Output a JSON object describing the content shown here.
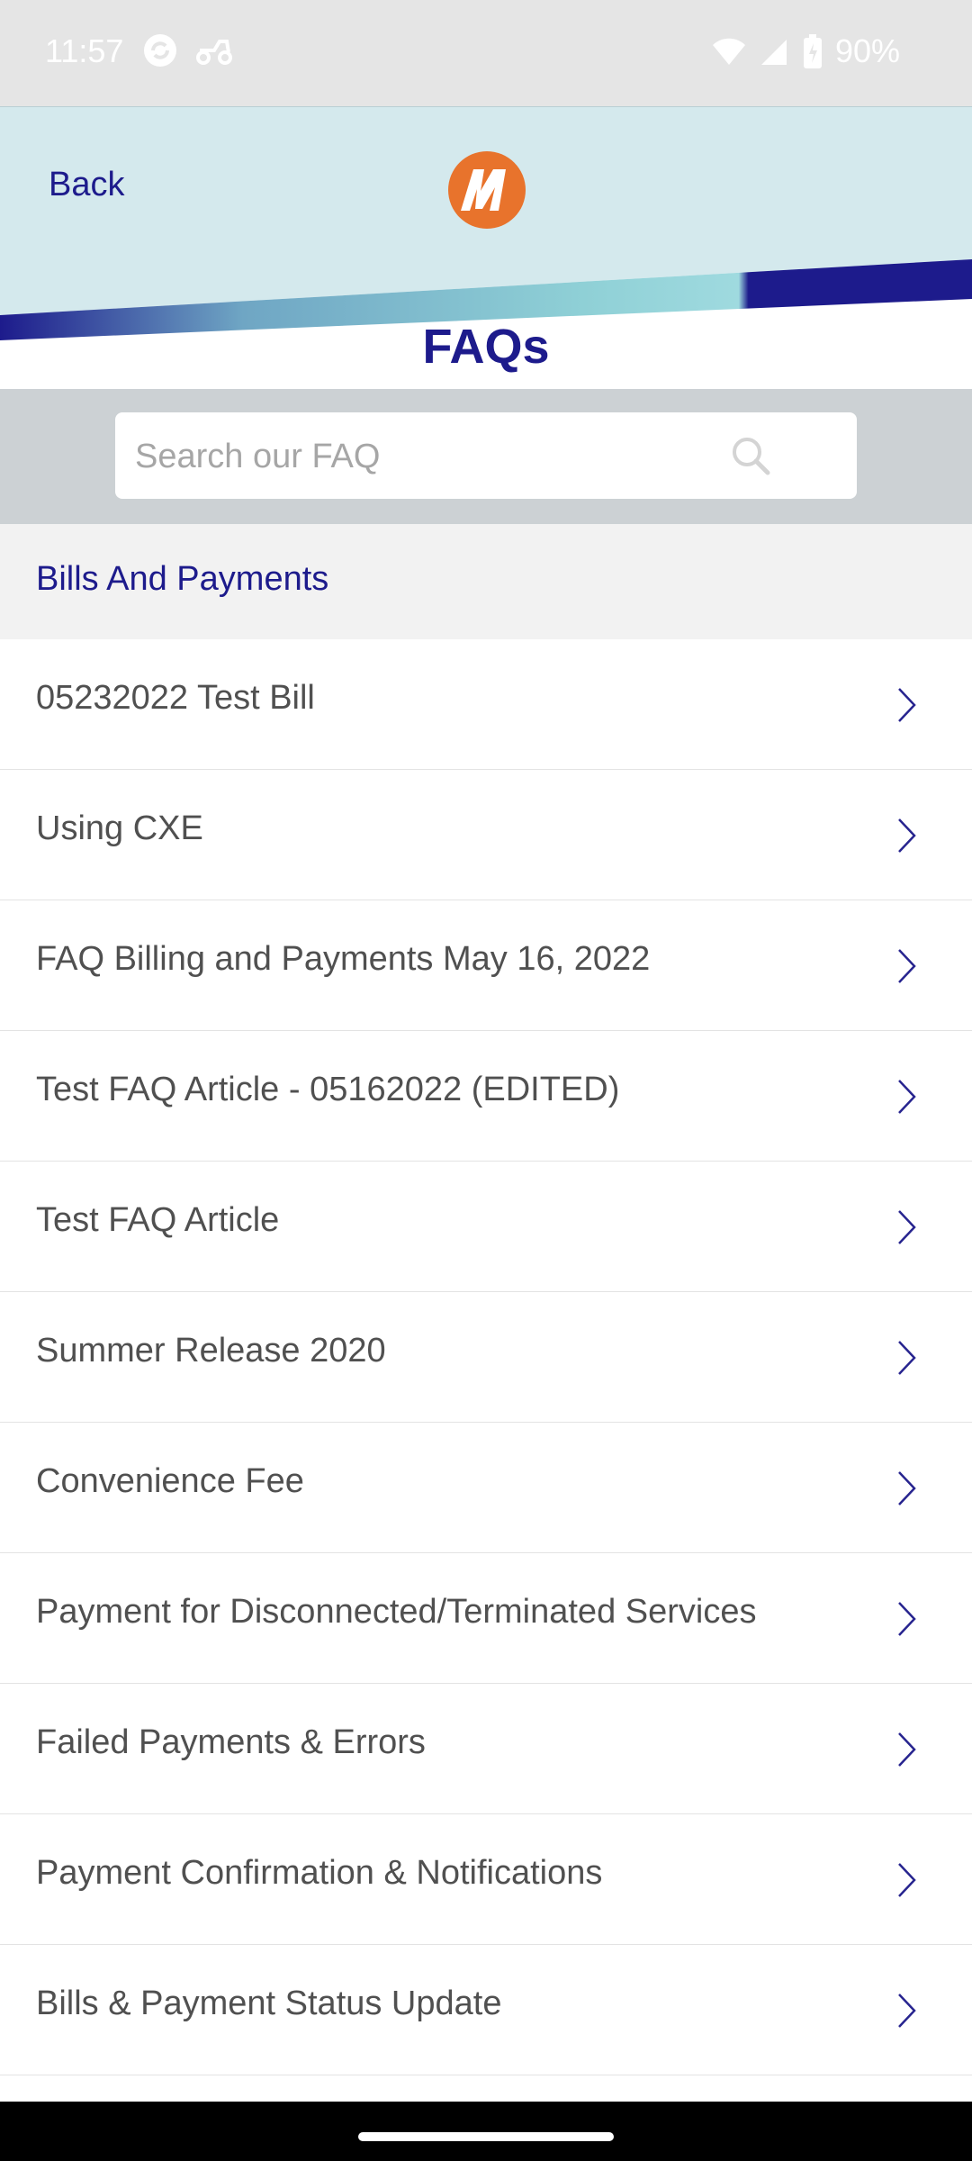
{
  "status_bar": {
    "time": "11:57",
    "battery": "90%"
  },
  "header": {
    "back_label": "Back",
    "title": "FAQs",
    "colors": {
      "light_blue": "#d4e9ed",
      "navy": "#1d1b8c",
      "teal": "#83c6cc",
      "logo_orange": "#e8732c"
    }
  },
  "search": {
    "placeholder": "Search our FAQ",
    "value": ""
  },
  "section": {
    "title": "Bills And Payments"
  },
  "faq_items": [
    {
      "label": "05232022 Test Bill"
    },
    {
      "label": "Using CXE"
    },
    {
      "label": "FAQ Billing and Payments May 16, 2022"
    },
    {
      "label": "Test FAQ Article - 05162022 (EDITED)"
    },
    {
      "label": "Test FAQ Article"
    },
    {
      "label": "Summer Release 2020"
    },
    {
      "label": "Convenience Fee"
    },
    {
      "label": "Payment for Disconnected/Terminated Services"
    },
    {
      "label": "Failed Payments & Errors"
    },
    {
      "label": "Payment Confirmation & Notifications"
    },
    {
      "label": "Bills & Payment Status Update"
    }
  ]
}
